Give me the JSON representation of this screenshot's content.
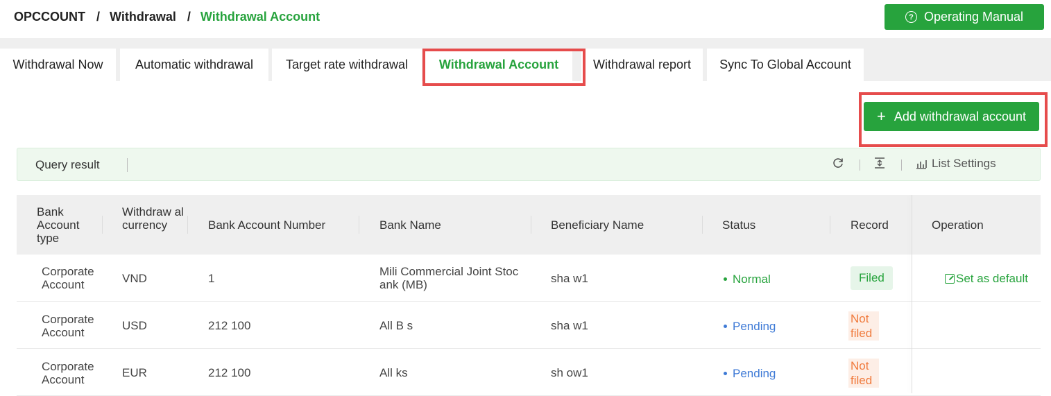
{
  "breadcrumb": {
    "root": "OPCCOUNT",
    "parent": "Withdrawal",
    "current": "Withdrawal Account",
    "sep": "/"
  },
  "header": {
    "manual_label": "Operating Manual",
    "manual_icon": "question-circle-icon"
  },
  "tabs": [
    {
      "label": "Withdrawal Now"
    },
    {
      "label": "Automatic withdrawal"
    },
    {
      "label": "Target rate withdrawal"
    },
    {
      "label": "Withdrawal Account",
      "active": true
    },
    {
      "label": "Withdrawal report"
    },
    {
      "label": "Sync To Global Account"
    }
  ],
  "add_button": {
    "label": "Add withdrawal account",
    "icon": "plus-icon"
  },
  "query": {
    "title": "Query result",
    "list_settings": "List Settings"
  },
  "columns": {
    "type": "Bank Account type",
    "currency": "Withdraw al currency",
    "account": "Bank Account Number",
    "bank": "Bank Name",
    "beneficiary": "Beneficiary Name",
    "status": "Status",
    "record": "Record",
    "operation": "Operation"
  },
  "rows": [
    {
      "type": "Corporate Account",
      "currency": "VND",
      "account": "1",
      "bank": "Mili Commercial Joint Stoc ank (MB)",
      "beneficiary": "sha w1",
      "status": "Normal",
      "record": "Filed",
      "operation": "Set as default"
    },
    {
      "type": "Corporate Account",
      "currency": "USD",
      "account": "212 100",
      "bank": "All B s",
      "beneficiary": "sha w1",
      "status": "Pending",
      "record": "Not filed",
      "operation": ""
    },
    {
      "type": "Corporate Account",
      "currency": "EUR",
      "account": "212 100",
      "bank": "All ks",
      "beneficiary": "sh ow1",
      "status": "Pending",
      "record": "Not filed",
      "operation": ""
    }
  ],
  "colors": {
    "accent": "#27a33d",
    "highlight": "#e64c4c",
    "pending": "#3e7ad6",
    "not_filed": "#f07a3c"
  }
}
